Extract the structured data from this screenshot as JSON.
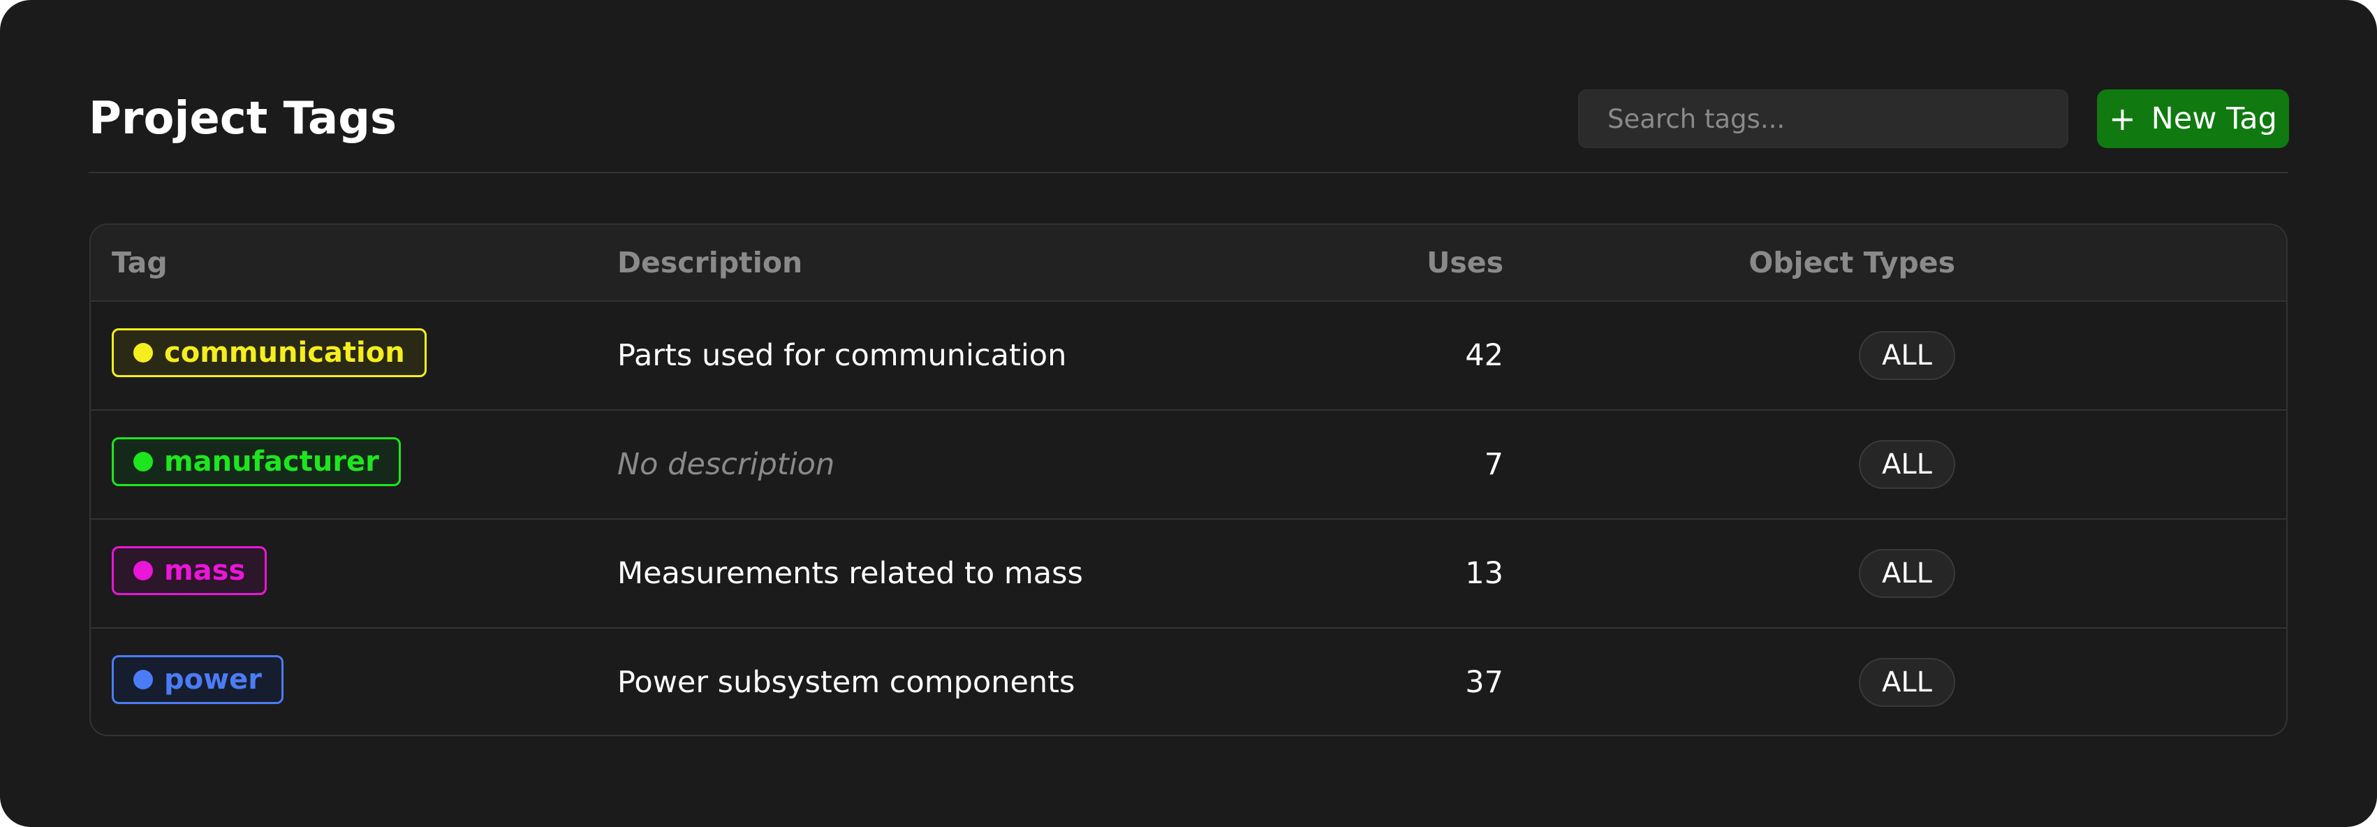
{
  "header": {
    "title": "Project Tags",
    "search_placeholder": "Search tags...",
    "new_tag_icon": "+",
    "new_tag_label": "New Tag"
  },
  "table": {
    "columns": {
      "tag": "Tag",
      "description": "Description",
      "uses": "Uses",
      "object_types": "Object Types"
    },
    "rows": [
      {
        "tag": "communication",
        "color": "#f5ee1f",
        "chip_bg": "#2a2915",
        "description": "Parts used for communication",
        "description_empty": false,
        "uses": "42",
        "object_types": "ALL"
      },
      {
        "tag": "manufacturer",
        "color": "#1ee61e",
        "chip_bg": "#15291a",
        "description": "No description",
        "description_empty": true,
        "uses": "7",
        "object_types": "ALL"
      },
      {
        "tag": "mass",
        "color": "#ea16d8",
        "chip_bg": "#2b162a",
        "description": "Measurements related to mass",
        "description_empty": false,
        "uses": "13",
        "object_types": "ALL"
      },
      {
        "tag": "power",
        "color": "#4c7cf5",
        "chip_bg": "#161d2e",
        "description": "Power subsystem components",
        "description_empty": false,
        "uses": "37",
        "object_types": "ALL"
      }
    ]
  }
}
